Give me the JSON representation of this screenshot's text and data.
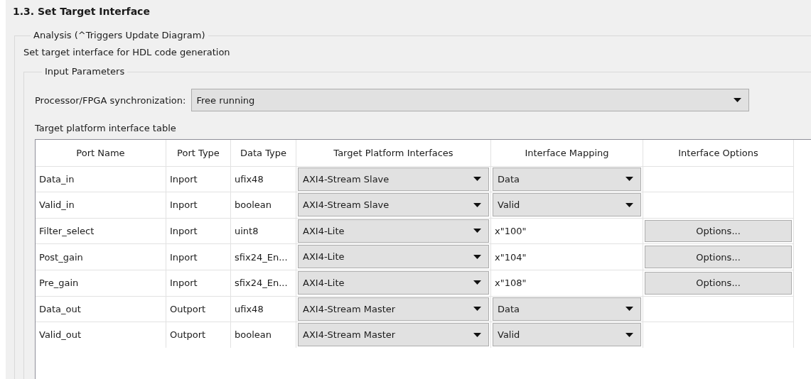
{
  "title": "1.3. Set Target Interface",
  "analysis": {
    "legend": "Analysis (^Triggers Update Diagram)",
    "description": "Set target interface for HDL code generation"
  },
  "input_parameters": {
    "legend": "Input Parameters",
    "sync_label": "Processor/FPGA synchronization:",
    "sync_value": "Free running",
    "table_label": "Target platform interface table"
  },
  "table": {
    "columns": [
      "Port Name",
      "Port Type",
      "Data Type",
      "Target Platform Interfaces",
      "Interface Mapping",
      "Interface Options"
    ],
    "rows": [
      {
        "port_name": "Data_in",
        "port_type": "Inport",
        "data_type": "ufix48",
        "interface": "AXI4-Stream Slave",
        "mapping": {
          "kind": "select",
          "value": "Data"
        }
      },
      {
        "port_name": "Valid_in",
        "port_type": "Inport",
        "data_type": "boolean",
        "interface": "AXI4-Stream Slave",
        "mapping": {
          "kind": "select",
          "value": "Valid"
        }
      },
      {
        "port_name": "Filter_select",
        "port_type": "Inport",
        "data_type": "uint8",
        "interface": "AXI4-Lite",
        "mapping": {
          "kind": "text",
          "value": "x\"100\""
        },
        "options_button": "Options..."
      },
      {
        "port_name": "Post_gain",
        "port_type": "Inport",
        "data_type": "sfix24_En...",
        "interface": "AXI4-Lite",
        "mapping": {
          "kind": "text",
          "value": "x\"104\""
        },
        "options_button": "Options..."
      },
      {
        "port_name": "Pre_gain",
        "port_type": "Inport",
        "data_type": "sfix24_En...",
        "interface": "AXI4-Lite",
        "mapping": {
          "kind": "text",
          "value": "x\"108\""
        },
        "options_button": "Options..."
      },
      {
        "port_name": "Data_out",
        "port_type": "Outport",
        "data_type": "ufix48",
        "interface": "AXI4-Stream Master",
        "mapping": {
          "kind": "select",
          "value": "Data"
        }
      },
      {
        "port_name": "Valid_out",
        "port_type": "Outport",
        "data_type": "boolean",
        "interface": "AXI4-Stream Master",
        "mapping": {
          "kind": "select",
          "value": "Valid"
        }
      }
    ]
  }
}
